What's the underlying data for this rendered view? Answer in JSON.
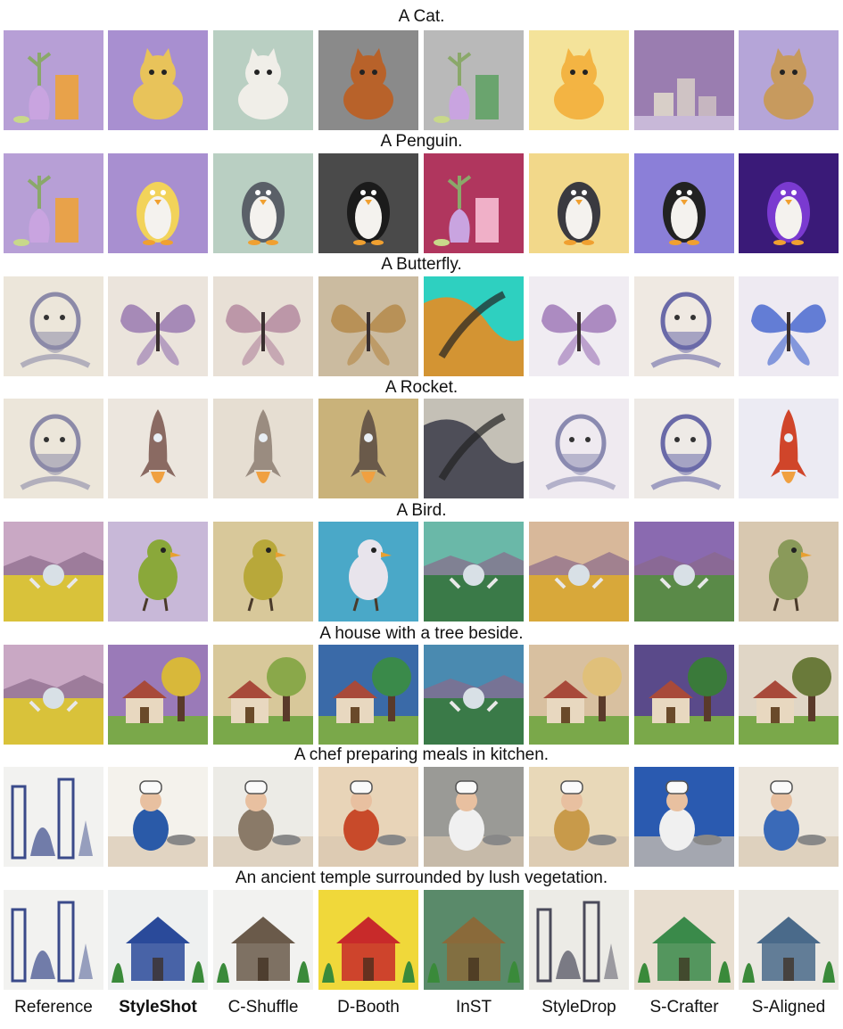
{
  "captions": [
    "A Cat.",
    "A Penguin.",
    "A Butterfly.",
    "A Rocket.",
    "A Bird.",
    "A house with a tree beside.",
    "A chef preparing meals in kitchen.",
    "An ancient temple surrounded by lush vegetation."
  ],
  "methods": [
    {
      "label": "Reference",
      "bold": false
    },
    {
      "label": "StyleShot",
      "bold": true
    },
    {
      "label": "C-Shuffle",
      "bold": false
    },
    {
      "label": "D-Booth",
      "bold": false
    },
    {
      "label": "InST",
      "bold": false
    },
    {
      "label": "StyleDrop",
      "bold": false
    },
    {
      "label": "S-Crafter",
      "bold": false
    },
    {
      "label": "S-Aligned",
      "bold": false
    }
  ],
  "rows": [
    {
      "tiles": [
        {
          "bg": "#b79fd6",
          "fg": "#e8a24a",
          "motif": "vase"
        },
        {
          "bg": "#a88fd0",
          "fg": "#e8c35a",
          "motif": "cat"
        },
        {
          "bg": "#b9cfc2",
          "fg": "#f0eee8",
          "motif": "cat"
        },
        {
          "bg": "#8a8a8a",
          "fg": "#b8622a",
          "motif": "cat"
        },
        {
          "bg": "#b9b9b9",
          "fg": "#6aa46e",
          "motif": "vase"
        },
        {
          "bg": "#f4e39a",
          "fg": "#f3b443",
          "motif": "cat"
        },
        {
          "bg": "#9a7db0",
          "fg": "#d8cfc8",
          "motif": "blocks"
        },
        {
          "bg": "#b5a5d8",
          "fg": "#c79a5e",
          "motif": "cat"
        }
      ]
    },
    {
      "tiles": [
        {
          "bg": "#b79fd6",
          "fg": "#e8a24a",
          "motif": "vase"
        },
        {
          "bg": "#a88fd0",
          "fg": "#f2d35a",
          "motif": "penguin"
        },
        {
          "bg": "#b9cfc2",
          "fg": "#5a6068",
          "motif": "penguin"
        },
        {
          "bg": "#4a4a4a",
          "fg": "#1b1b1b",
          "motif": "penguin"
        },
        {
          "bg": "#b0365e",
          "fg": "#f0b0c8",
          "motif": "vase"
        },
        {
          "bg": "#f2d88a",
          "fg": "#3a3a40",
          "motif": "penguin"
        },
        {
          "bg": "#8b7fd8",
          "fg": "#222222",
          "motif": "penguin"
        },
        {
          "bg": "#3a1a78",
          "fg": "#7a3ad0",
          "motif": "penguin"
        }
      ]
    },
    {
      "tiles": [
        {
          "bg": "#ece6da",
          "fg": "#8c8aa8",
          "motif": "face"
        },
        {
          "bg": "#ebe4dc",
          "fg": "#9a7ab0",
          "motif": "butterfly"
        },
        {
          "bg": "#e8e0d6",
          "fg": "#b48aa0",
          "motif": "butterfly"
        },
        {
          "bg": "#cbbba0",
          "fg": "#b58a4a",
          "motif": "butterfly"
        },
        {
          "bg": "#2ed0c0",
          "fg": "#f08a1a",
          "motif": "abstract"
        },
        {
          "bg": "#f0ecf2",
          "fg": "#a07ab8",
          "motif": "butterfly"
        },
        {
          "bg": "#efe9e2",
          "fg": "#6a6aa8",
          "motif": "face"
        },
        {
          "bg": "#eeeaf2",
          "fg": "#4a6ad0",
          "motif": "butterfly"
        }
      ]
    },
    {
      "tiles": [
        {
          "bg": "#ece6da",
          "fg": "#8c8aa8",
          "motif": "face"
        },
        {
          "bg": "#ece6de",
          "fg": "#8a6a62",
          "motif": "rocket"
        },
        {
          "bg": "#e6ded2",
          "fg": "#9a8c80",
          "motif": "rocket"
        },
        {
          "bg": "#c9b27a",
          "fg": "#6a5a4a",
          "motif": "rocket"
        },
        {
          "bg": "#c4c0b6",
          "fg": "#3a3a48",
          "motif": "abstract"
        },
        {
          "bg": "#efeaf0",
          "fg": "#8a8ab0",
          "motif": "face"
        },
        {
          "bg": "#eeeae6",
          "fg": "#6a6aa8",
          "motif": "face"
        },
        {
          "bg": "#ecebf3",
          "fg": "#d0452a",
          "motif": "rocket"
        }
      ]
    },
    {
      "tiles": [
        {
          "bg": "#c9a8c4",
          "fg": "#d9c23a",
          "motif": "landscape"
        },
        {
          "bg": "#c8b8d8",
          "fg": "#8aa83a",
          "motif": "bird"
        },
        {
          "bg": "#d8c89a",
          "fg": "#b8a83a",
          "motif": "bird"
        },
        {
          "bg": "#4aa8c8",
          "fg": "#e8e4ec",
          "motif": "bird"
        },
        {
          "bg": "#6ab8a8",
          "fg": "#3a7a48",
          "motif": "landscape"
        },
        {
          "bg": "#d8b89a",
          "fg": "#d8a83a",
          "motif": "landscape"
        },
        {
          "bg": "#8a6ab0",
          "fg": "#5a8a48",
          "motif": "landscape"
        },
        {
          "bg": "#d8c8b0",
          "fg": "#8a9a5a",
          "motif": "bird"
        }
      ]
    },
    {
      "tiles": [
        {
          "bg": "#c9a8c4",
          "fg": "#d9c23a",
          "motif": "landscape"
        },
        {
          "bg": "#9a7ab8",
          "fg": "#d8b83a",
          "motif": "house"
        },
        {
          "bg": "#d8c89a",
          "fg": "#8aa84a",
          "motif": "house"
        },
        {
          "bg": "#3a6aa8",
          "fg": "#3a8a4a",
          "motif": "house"
        },
        {
          "bg": "#4a8ab0",
          "fg": "#3a7a48",
          "motif": "landscape"
        },
        {
          "bg": "#d8c0a0",
          "fg": "#e0c07a",
          "motif": "house"
        },
        {
          "bg": "#5a4a8a",
          "fg": "#3a7a3a",
          "motif": "house"
        },
        {
          "bg": "#e0d6c6",
          "fg": "#6a7a3a",
          "motif": "house"
        }
      ]
    },
    {
      "tiles": [
        {
          "bg": "#f2f2f0",
          "fg": "#3a4a8a",
          "motif": "city"
        },
        {
          "bg": "#f4f2ec",
          "fg": "#2a5aa8",
          "motif": "chef"
        },
        {
          "bg": "#ecebe6",
          "fg": "#8a7a68",
          "motif": "chef"
        },
        {
          "bg": "#e8d4b8",
          "fg": "#c84a2a",
          "motif": "chef"
        },
        {
          "bg": "#9a9a96",
          "fg": "#f0f0f0",
          "motif": "chef"
        },
        {
          "bg": "#e8d8b8",
          "fg": "#c89a4a",
          "motif": "chef"
        },
        {
          "bg": "#2a5ab0",
          "fg": "#f0f0f0",
          "motif": "chef"
        },
        {
          "bg": "#ece6dc",
          "fg": "#3a6ab8",
          "motif": "chef"
        }
      ]
    },
    {
      "tiles": [
        {
          "bg": "#f2f2f0",
          "fg": "#3a4a8a",
          "motif": "city"
        },
        {
          "bg": "#eef0f0",
          "fg": "#2a4a9a",
          "motif": "temple"
        },
        {
          "bg": "#f2f2f0",
          "fg": "#6a5a4a",
          "motif": "temple"
        },
        {
          "bg": "#f0d83a",
          "fg": "#c82a2a",
          "motif": "temple"
        },
        {
          "bg": "#5a8a6a",
          "fg": "#8a6a3a",
          "motif": "temple"
        },
        {
          "bg": "#ecebe6",
          "fg": "#4a4a5a",
          "motif": "city"
        },
        {
          "bg": "#e8ded0",
          "fg": "#3a8a4a",
          "motif": "temple"
        },
        {
          "bg": "#ebe8e2",
          "fg": "#4a6a8a",
          "motif": "temple"
        }
      ]
    }
  ]
}
